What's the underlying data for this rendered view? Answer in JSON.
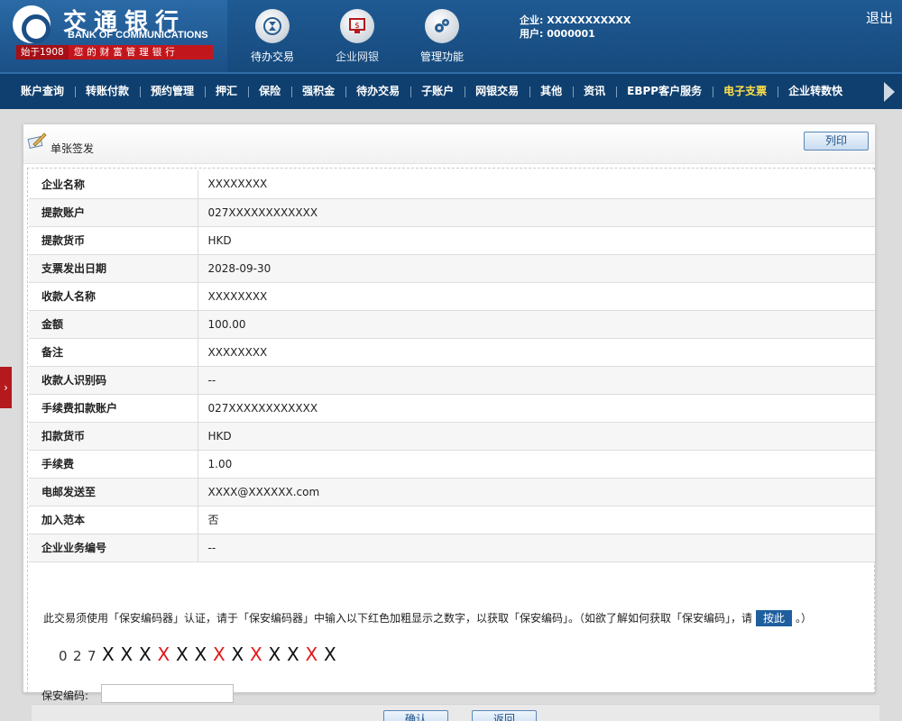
{
  "header": {
    "bank_name_cn": "交通银行",
    "bank_name_en": "BANK OF COMMUNICATIONS",
    "since": "始于1908",
    "motto": "您的财富管理银行",
    "nav": [
      {
        "label": "待办交易",
        "icon": "hourglass-icon"
      },
      {
        "label": "企业网银",
        "icon": "monitor-dollar-icon"
      },
      {
        "label": "管理功能",
        "icon": "gears-icon"
      }
    ],
    "company_label": "企业: XXXXXXXXXXX",
    "user_label": "用户: 0000001",
    "logout": "退出"
  },
  "menu": {
    "items": [
      "账户查询",
      "转账付款",
      "预约管理",
      "押汇",
      "保险",
      "强积金",
      "待办交易",
      "子账户",
      "网银交易",
      "其他",
      "资讯",
      "EBPP客户服务",
      "电子支票",
      "企业转数快"
    ],
    "active": "电子支票"
  },
  "side_tab": "›",
  "panel": {
    "title": "单张签发",
    "print_label": "列印",
    "rows": [
      {
        "label": "企业名称",
        "value": "XXXXXXXX"
      },
      {
        "label": "提款账户",
        "value": "027XXXXXXXXXXXX"
      },
      {
        "label": "提款货币",
        "value": "HKD"
      },
      {
        "label": "支票发出日期",
        "value": "2028-09-30"
      },
      {
        "label": "收款人名称",
        "value": "XXXXXXXX"
      },
      {
        "label": "金额",
        "value": "100.00"
      },
      {
        "label": "备注",
        "value": "XXXXXXXX"
      },
      {
        "label": "收款人识别码",
        "value": "--"
      },
      {
        "label": "手续费扣款账户",
        "value": "027XXXXXXXXXXXX"
      },
      {
        "label": "扣款货币",
        "value": "HKD"
      },
      {
        "label": "手续费",
        "value": "1.00"
      },
      {
        "label": "电邮发送至",
        "value": "XXXX@XXXXXX.com"
      },
      {
        "label": "加入范本",
        "value": "否"
      },
      {
        "label": "企业业务编号",
        "value": "--"
      }
    ],
    "notice_before": "此交易须使用「保安编码器」认证，请于「保安编码器」中输入以下红色加粗显示之数字，以获取「保安编码」。（如欲了解如何获取「保安编码」，请",
    "notice_button": "按此",
    "notice_after": "。）",
    "digits": [
      {
        "ch": "0",
        "style": "plain"
      },
      {
        "ch": "2",
        "style": "plain"
      },
      {
        "ch": "7",
        "style": "plain"
      },
      {
        "ch": "X",
        "style": "bold"
      },
      {
        "ch": "X",
        "style": "bold"
      },
      {
        "ch": "X",
        "style": "bold"
      },
      {
        "ch": "X",
        "style": "red"
      },
      {
        "ch": "X",
        "style": "bold"
      },
      {
        "ch": "X",
        "style": "bold"
      },
      {
        "ch": "X",
        "style": "red"
      },
      {
        "ch": "X",
        "style": "bold"
      },
      {
        "ch": "X",
        "style": "red"
      },
      {
        "ch": "X",
        "style": "bold"
      },
      {
        "ch": "X",
        "style": "bold"
      },
      {
        "ch": "X",
        "style": "red"
      },
      {
        "ch": "X",
        "style": "bold"
      }
    ],
    "code_label": "保安编码:",
    "code_value": "",
    "confirm_label": "确认",
    "back_label": "返回"
  },
  "colors": {
    "header_blue": "#164a7d",
    "menu_blue": "#0f3f6e",
    "active_menu": "#ffe04a",
    "brand_red": "#c2161d",
    "digit_red": "#e01818"
  }
}
